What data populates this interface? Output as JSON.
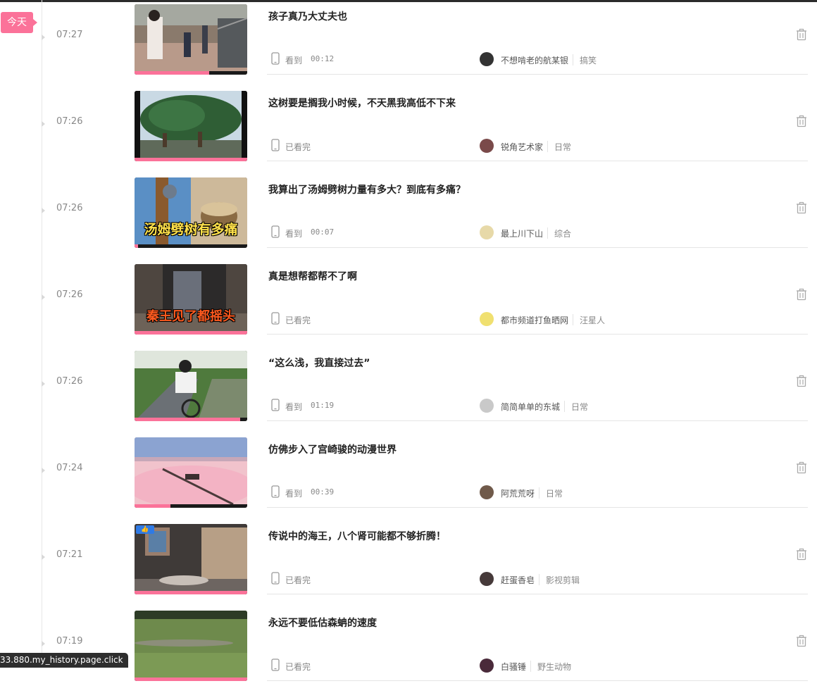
{
  "today_label": "今天",
  "status_bar_url": "33.880.my_history.page.click",
  "icons": {
    "device": "phone-icon",
    "delete": "trash-icon"
  },
  "items": [
    {
      "time": "07:27",
      "title": "孩子真乃大丈夫也",
      "status": "看到",
      "progress_text": "00:12",
      "progress": 0.66,
      "uploader": "不想啃老的航某银",
      "category": "搞笑"
    },
    {
      "time": "07:26",
      "title": "这树要是搁我小时候，不天黑我高低不下来",
      "status": "已看完",
      "progress_text": "",
      "progress": 1.0,
      "uploader": "锐角艺术家",
      "category": "日常"
    },
    {
      "time": "07:26",
      "title": "我算出了汤姆劈树力量有多大？到底有多痛？",
      "status": "看到",
      "progress_text": "00:07",
      "progress": 0.03,
      "uploader": "最上川下山",
      "category": "综合",
      "thumb_caption": "汤姆劈树有多痛"
    },
    {
      "time": "07:26",
      "title": "真是想帮都帮不了啊",
      "status": "已看完",
      "progress_text": "",
      "progress": 1.0,
      "uploader": "都市频道打鱼晒网",
      "category": "汪星人",
      "thumb_caption": "秦王见了都摇头"
    },
    {
      "time": "07:26",
      "title": "“这么浅，我直接过去”",
      "status": "看到",
      "progress_text": "01:19",
      "progress": 0.94,
      "uploader": "简简单单的东城",
      "category": "日常"
    },
    {
      "time": "07:24",
      "title": "仿佛步入了宫崎骏的动漫世界",
      "status": "看到",
      "progress_text": "00:39",
      "progress": 0.32,
      "uploader": "阿荒荒呀",
      "category": "日常"
    },
    {
      "time": "07:21",
      "title": "传说中的海王，八个肾可能都不够折腾！",
      "status": "已看完",
      "progress_text": "",
      "progress": 1.0,
      "uploader": "赶蛋香皂",
      "category": "影视剪辑"
    },
    {
      "time": "07:19",
      "title": "永远不要低估森蚺的速度",
      "status": "已看完",
      "progress_text": "",
      "progress": 1.0,
      "uploader": "白骚锤",
      "category": "野生动物"
    }
  ]
}
